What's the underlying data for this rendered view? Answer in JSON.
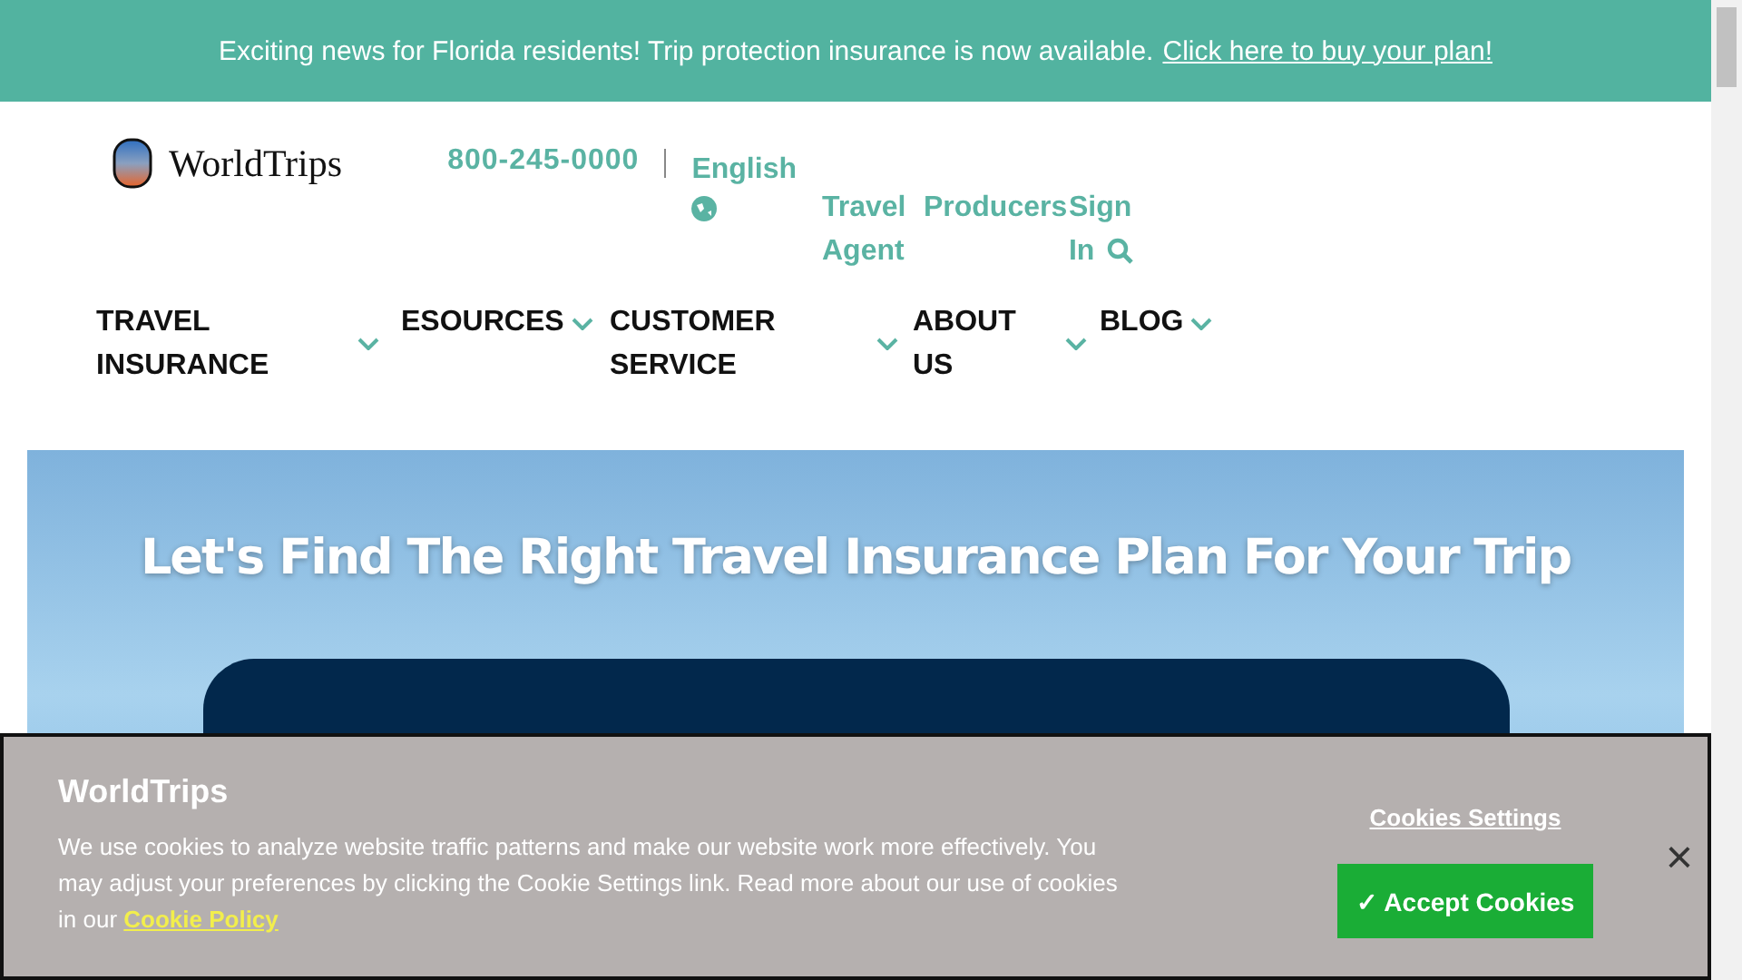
{
  "banner": {
    "text": "Exciting news for Florida residents! Trip protection insurance is now available.",
    "link": "Click here to buy your plan!"
  },
  "header": {
    "logo": "WorldTrips",
    "phone": "800-245-0000",
    "language": "English",
    "links": [
      "Travel Agent",
      "Producers",
      "Sign In"
    ]
  },
  "nav": [
    {
      "label": "TRAVEL INSURANCE",
      "expanded": false
    },
    {
      "label": "ESOURCES",
      "expanded": false
    },
    {
      "label": "CUSTOMER SERVICE",
      "expanded": false
    },
    {
      "label": "ABOUT US",
      "expanded": false
    },
    {
      "label": "BLOG",
      "expanded": false
    }
  ],
  "hero": {
    "title": "Let's Find The Right Travel Insurance Plan For Your Trip"
  },
  "cookie_banner": {
    "title": "WorldTrips",
    "text": "We use cookies to analyze website traffic patterns and make our website work more effectively. You may adjust your preferences by clicking the Cookie Settings link. Read more about our use of cookies in our",
    "policy_link": "Cookie Policy",
    "settings": "Cookies Settings",
    "accept": "✓ Accept Cookies",
    "close": "×"
  }
}
